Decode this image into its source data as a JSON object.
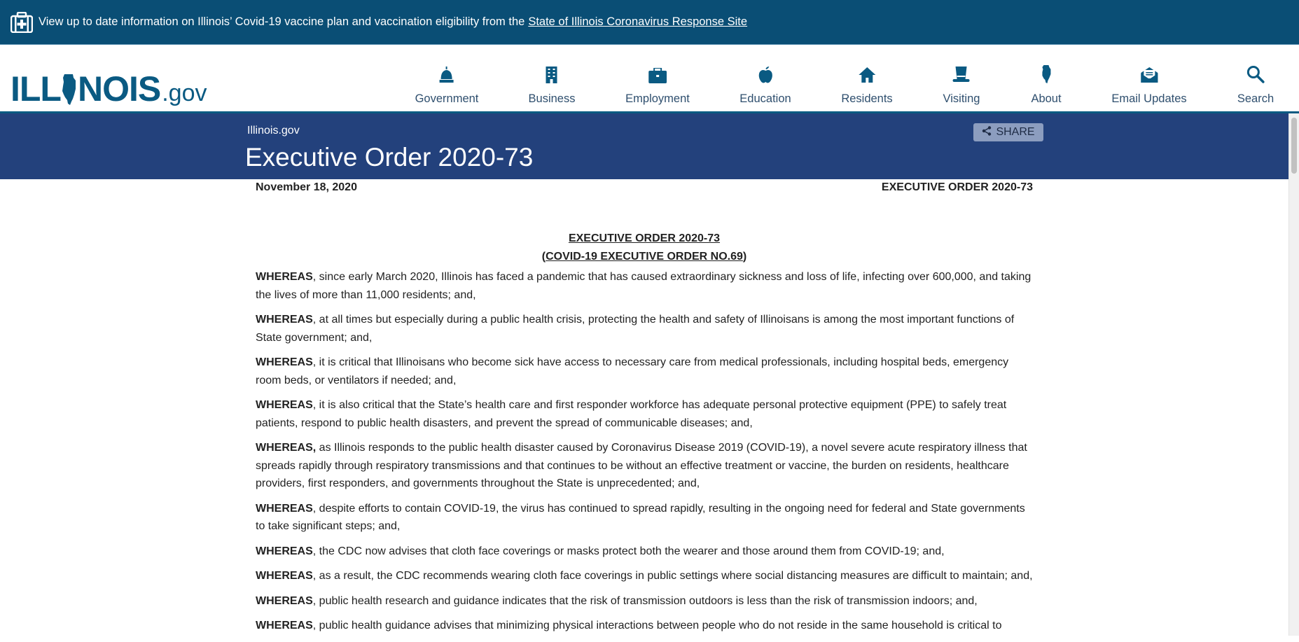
{
  "alert": {
    "text": "View up to date information on Illinois’ Covid-19 vaccine plan and vaccination eligibility from the",
    "link": "State of Illinois Coronavirus Response Site"
  },
  "logo": {
    "left": "ILL",
    "right": "NOIS",
    "gov": ".gov"
  },
  "nav": [
    {
      "label": "Government",
      "icon": "capitol-icon"
    },
    {
      "label": "Business",
      "icon": "building-icon"
    },
    {
      "label": "Employment",
      "icon": "briefcase-icon"
    },
    {
      "label": "Education",
      "icon": "apple-icon"
    },
    {
      "label": "Residents",
      "icon": "house-icon"
    },
    {
      "label": "Visiting",
      "icon": "top-hat-icon"
    },
    {
      "label": "About",
      "icon": "illinois-map-icon"
    },
    {
      "label": "Email Updates",
      "icon": "envelope-icon"
    },
    {
      "label": "Search",
      "icon": "search-icon"
    }
  ],
  "band": {
    "breadcrumb": "Illinois.gov",
    "title": "Executive Order 2020-73",
    "share": "SHARE"
  },
  "meta": {
    "date": "November 18, 2020",
    "order": "EXECUTIVE ORDER 2020-73"
  },
  "doc": {
    "heading": "EXECUTIVE ORDER 2020-73",
    "sub_open": "(",
    "sub_text": "COVID-19 EXECUTIVE ORDER NO.69",
    "sub_close": ")",
    "paragraphs": [
      {
        "lead": "WHEREAS",
        "text": ", since early March 2020, Illinois has faced a pandemic that has caused extraordinary sickness and loss of life, infecting over 600,000, and taking the lives of more than 11,000 residents; and,"
      },
      {
        "lead": "WHEREAS",
        "text": ", at all times but especially during a public health crisis, protecting the health and safety of Illinoisans is among the most important functions of State government; and,"
      },
      {
        "lead": "WHEREAS",
        "text": ", it is critical that Illinoisans who become sick have access to necessary care from medical professionals, including hospital beds, emergency room beds, or ventilators if needed; and,"
      },
      {
        "lead": "WHEREAS",
        "text": ", it is also critical that the State’s health care and first responder workforce has adequate personal protective equipment (PPE) to safely treat patients, respond to public health disasters, and prevent the spread of communicable diseases; and,"
      },
      {
        "lead": "WHEREAS,",
        "text": " as Illinois responds to the public health disaster caused by Coronavirus Disease 2019 (COVID-19), a novel severe acute respiratory illness that spreads rapidly through respiratory transmissions and that continues to be without an effective treatment or vaccine, the burden on residents, healthcare providers, first responders, and governments throughout the State is unprecedented; and,"
      },
      {
        "lead": "WHEREAS",
        "text": ", despite efforts to contain COVID-19, the virus has continued to spread rapidly, resulting in the ongoing need for federal and State governments to take significant steps; and,"
      },
      {
        "lead": "WHEREAS",
        "text": ", the CDC now advises that cloth face coverings or masks protect both the wearer and those around them from COVID-19; and,"
      },
      {
        "lead": "WHEREAS",
        "text": ", as a result, the CDC recommends wearing cloth face coverings in public settings where social distancing measures are difficult to maintain; and,"
      },
      {
        "lead": "WHEREAS",
        "text": ", public health research and guidance indicates that the risk of transmission outdoors is less than the risk of transmission indoors; and,"
      },
      {
        "lead": "WHEREAS",
        "text": ", public health guidance advises that minimizing physical interactions between people who do not reside in the same household is critical to"
      }
    ]
  }
}
